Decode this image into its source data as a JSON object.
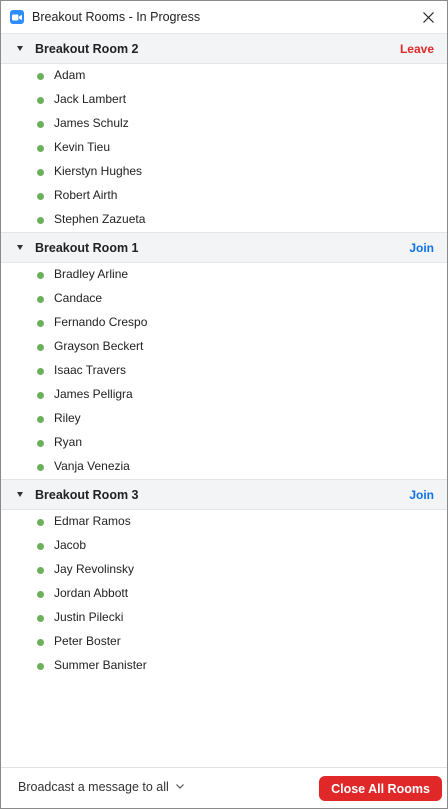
{
  "window": {
    "title": "Breakout Rooms - In Progress"
  },
  "rooms": [
    {
      "name": "Breakout Room 2",
      "action": "Leave",
      "members": [
        "Adam",
        "Jack Lambert",
        "James Schulz",
        "Kevin Tieu",
        "Kierstyn Hughes",
        "Robert Airth",
        "Stephen Zazueta"
      ]
    },
    {
      "name": "Breakout Room 1",
      "action": "Join",
      "members": [
        "Bradley Arline",
        "Candace",
        "Fernando Crespo",
        "Grayson Beckert",
        "Isaac Travers",
        "James Pelligra",
        "Riley",
        "Ryan",
        "Vanja Venezia"
      ]
    },
    {
      "name": "Breakout Room 3",
      "action": "Join",
      "members": [
        "Edmar Ramos",
        "Jacob",
        "Jay Revolinsky",
        "Jordan Abbott",
        "Justin Pilecki",
        "Peter Boster",
        "Summer Banister"
      ]
    }
  ],
  "footer": {
    "broadcast_label": "Broadcast a message to all",
    "close_all_label": "Close All Rooms"
  },
  "colors": {
    "accent": "#2D8CFF",
    "leave": "#e02828",
    "join": "#0e71eb",
    "online_dot": "#6cb05c",
    "close_all_bg": "#e02828"
  },
  "icons": {
    "app": "zoom-camera-icon",
    "close": "close-icon",
    "caret": "caret-down-icon",
    "status": "online-status-dot-icon",
    "broadcast_chevron": "chevron-down-icon"
  }
}
